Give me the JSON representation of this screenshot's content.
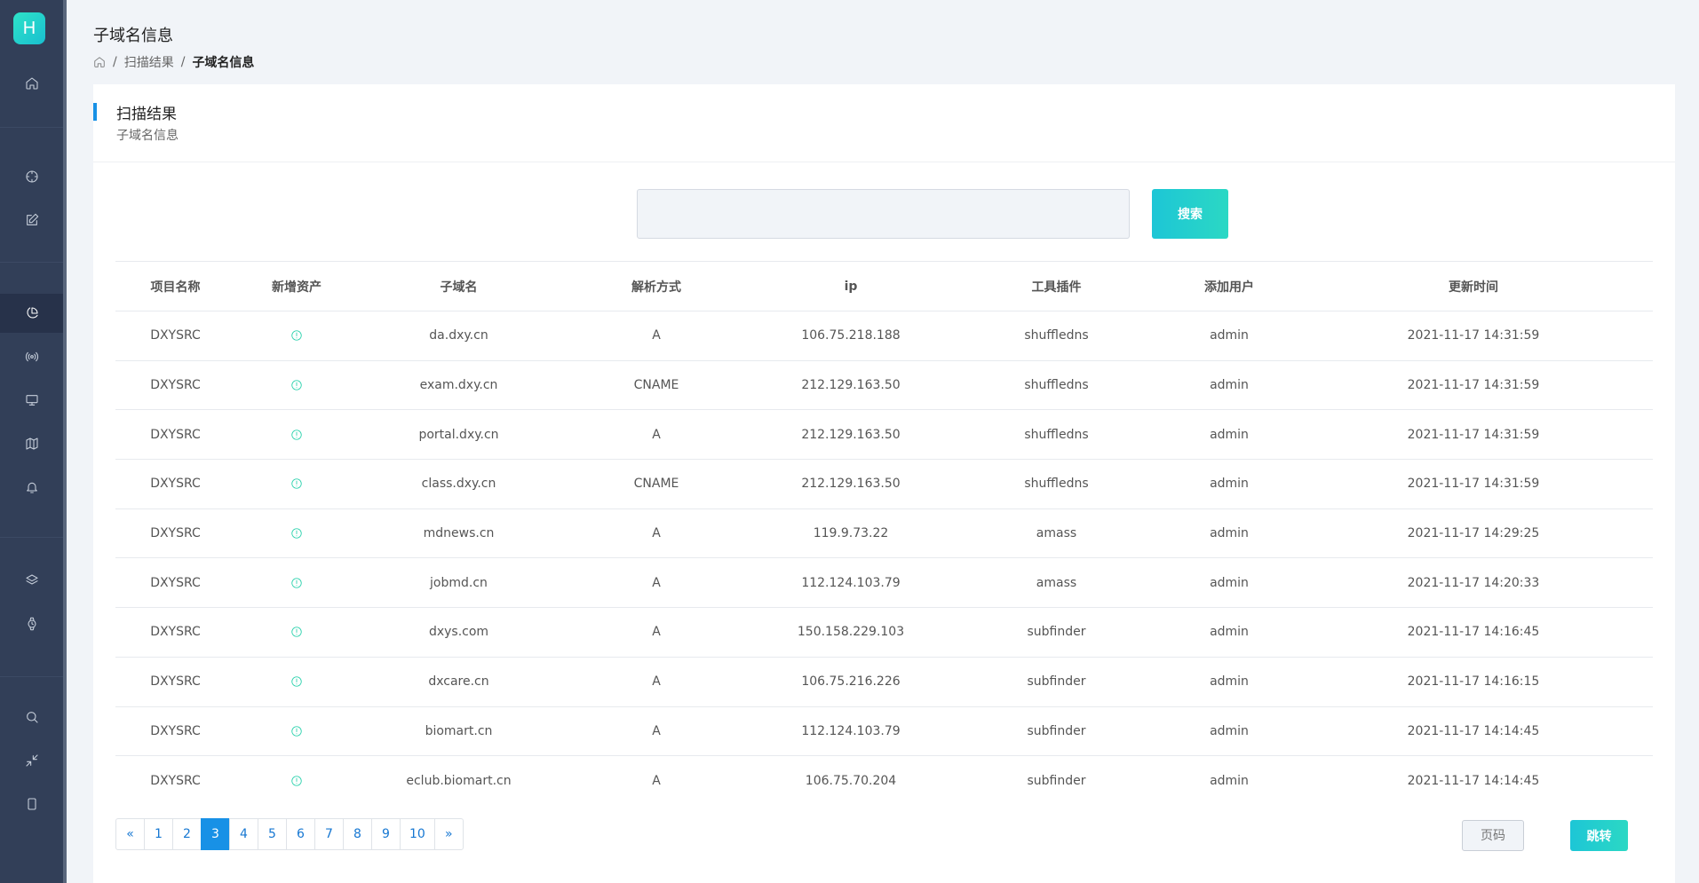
{
  "app": {
    "logo_letter": "H"
  },
  "sidebar": {
    "items": [
      {
        "icon": "home-icon"
      },
      {
        "icon": "crosshair-icon"
      },
      {
        "icon": "edit-icon"
      },
      {
        "icon": "pie-chart-icon",
        "active": true
      },
      {
        "icon": "broadcast-icon"
      },
      {
        "icon": "monitor-icon"
      },
      {
        "icon": "map-icon"
      },
      {
        "icon": "bell-icon"
      },
      {
        "icon": "layers-icon"
      },
      {
        "icon": "watch-icon"
      },
      {
        "icon": "search-icon"
      },
      {
        "icon": "minimize-icon"
      },
      {
        "icon": "tablet-icon"
      }
    ]
  },
  "header": {
    "title": "子域名信息",
    "breadcrumb": {
      "sep": "/",
      "parent": "扫描结果",
      "current": "子域名信息"
    }
  },
  "card": {
    "title": "扫描结果",
    "subtitle": "子域名信息"
  },
  "search": {
    "value": "",
    "button": "搜索"
  },
  "table": {
    "headers": [
      "项目名称",
      "新增资产",
      "子域名",
      "解析方式",
      "ip",
      "工具插件",
      "添加用户",
      "更新时间"
    ],
    "rows": [
      {
        "project": "DXYSRC",
        "subdomain": "da.dxy.cn",
        "type": "A",
        "ip": "106.75.218.188",
        "tool": "shuffledns",
        "user": "admin",
        "time": "2021-11-17 14:31:59"
      },
      {
        "project": "DXYSRC",
        "subdomain": "exam.dxy.cn",
        "type": "CNAME",
        "ip": "212.129.163.50",
        "tool": "shuffledns",
        "user": "admin",
        "time": "2021-11-17 14:31:59"
      },
      {
        "project": "DXYSRC",
        "subdomain": "portal.dxy.cn",
        "type": "A",
        "ip": "212.129.163.50",
        "tool": "shuffledns",
        "user": "admin",
        "time": "2021-11-17 14:31:59"
      },
      {
        "project": "DXYSRC",
        "subdomain": "class.dxy.cn",
        "type": "CNAME",
        "ip": "212.129.163.50",
        "tool": "shuffledns",
        "user": "admin",
        "time": "2021-11-17 14:31:59"
      },
      {
        "project": "DXYSRC",
        "subdomain": "mdnews.cn",
        "type": "A",
        "ip": "119.9.73.22",
        "tool": "amass",
        "user": "admin",
        "time": "2021-11-17 14:29:25"
      },
      {
        "project": "DXYSRC",
        "subdomain": "jobmd.cn",
        "type": "A",
        "ip": "112.124.103.79",
        "tool": "amass",
        "user": "admin",
        "time": "2021-11-17 14:20:33"
      },
      {
        "project": "DXYSRC",
        "subdomain": "dxys.com",
        "type": "A",
        "ip": "150.158.229.103",
        "tool": "subfinder",
        "user": "admin",
        "time": "2021-11-17 14:16:45"
      },
      {
        "project": "DXYSRC",
        "subdomain": "dxcare.cn",
        "type": "A",
        "ip": "106.75.216.226",
        "tool": "subfinder",
        "user": "admin",
        "time": "2021-11-17 14:16:15"
      },
      {
        "project": "DXYSRC",
        "subdomain": "biomart.cn",
        "type": "A",
        "ip": "112.124.103.79",
        "tool": "subfinder",
        "user": "admin",
        "time": "2021-11-17 14:14:45"
      },
      {
        "project": "DXYSRC",
        "subdomain": "eclub.biomart.cn",
        "type": "A",
        "ip": "106.75.70.204",
        "tool": "subfinder",
        "user": "admin",
        "time": "2021-11-17 14:14:45"
      }
    ]
  },
  "pagination": {
    "prev": "«",
    "next": "»",
    "pages": [
      "1",
      "2",
      "3",
      "4",
      "5",
      "6",
      "7",
      "8",
      "9",
      "10"
    ],
    "current": "3",
    "page_input_placeholder": "页码",
    "jump_button": "跳转"
  },
  "colors": {
    "accent": "#1891e6",
    "teal": "#1fcfa8",
    "sidebar": "#323f58"
  }
}
